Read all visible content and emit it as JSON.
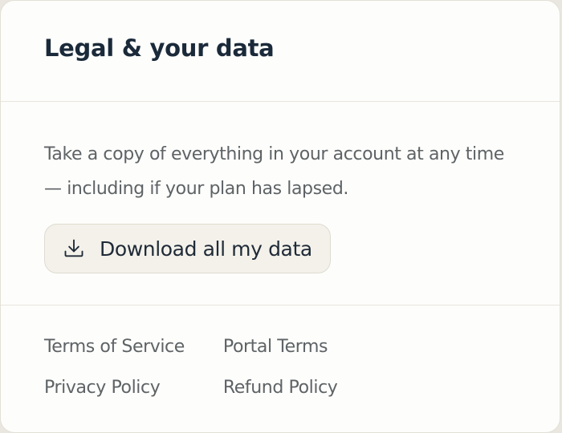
{
  "section": {
    "title": "Legal & your data",
    "description": "Take a copy of everything in your account at any time — including if your plan has lapsed.",
    "download_button": {
      "icon": "download-icon",
      "label": "Download all my data"
    }
  },
  "links": [
    {
      "label": "Terms of Service"
    },
    {
      "label": "Portal Terms"
    },
    {
      "label": "Privacy Policy"
    },
    {
      "label": "Refund Policy"
    }
  ],
  "colors": {
    "title": "#1b2a3a",
    "body_text": "#5e6366",
    "button_bg": "#f3f1ea",
    "card_bg": "#fdfdfb"
  }
}
